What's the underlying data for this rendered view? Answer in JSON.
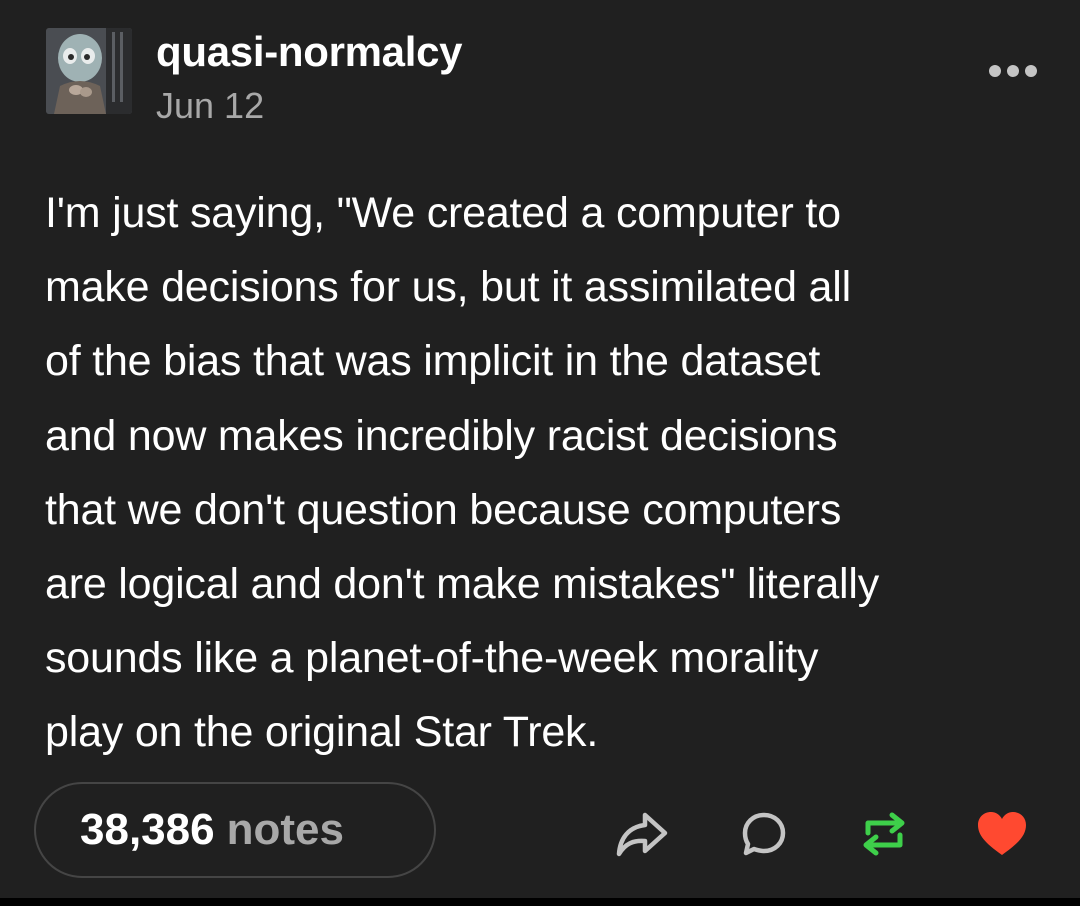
{
  "post": {
    "username": "quasi-normalcy",
    "date": "Jun 12",
    "body_lines": [
      "I'm just saying, \"We created a computer to",
      "make decisions for us, but it assimilated all",
      "of the bias that was implicit in the dataset",
      "and now makes incredibly racist decisions",
      "that we don't question because computers",
      "are logical and don't make mistakes\" literally",
      "sounds like a planet-of-the-week morality",
      "play on the original Star Trek."
    ]
  },
  "footer": {
    "notes_count": "38,386",
    "notes_label": "notes"
  },
  "icons": {
    "more": "more-horizontal-icon",
    "share": "share-icon",
    "reply": "reply-icon",
    "reblog": "reblog-icon",
    "like": "heart-icon"
  },
  "colors": {
    "background": "#202020",
    "secondary_text": "#a8a8a8",
    "reblog_green": "#3ecf4a",
    "like_red": "#ff4930"
  }
}
